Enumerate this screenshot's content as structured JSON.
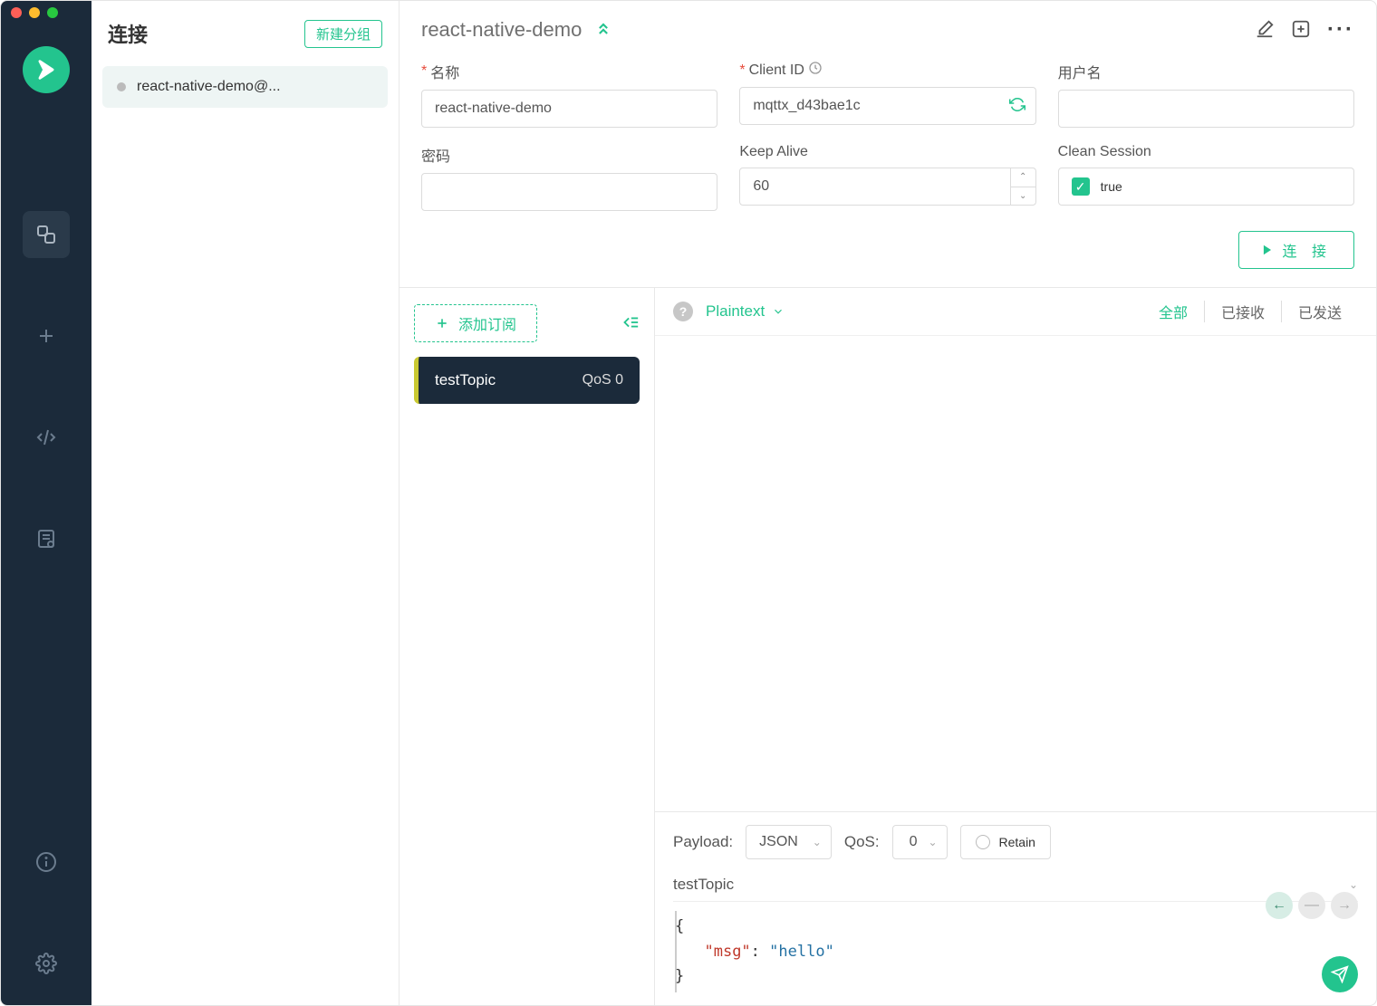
{
  "sidebar": {
    "title": "连接",
    "new_group": "新建分组",
    "connections": [
      {
        "name": "react-native-demo@..."
      }
    ]
  },
  "header": {
    "title": "react-native-demo"
  },
  "form": {
    "name_label": "名称",
    "name_value": "react-native-demo",
    "client_id_label": "Client ID",
    "client_id_value": "mqttx_d43bae1c",
    "username_label": "用户名",
    "username_value": "",
    "password_label": "密码",
    "password_value": "",
    "keep_alive_label": "Keep Alive",
    "keep_alive_value": "60",
    "clean_session_label": "Clean Session",
    "clean_session_value": "true",
    "connect_btn": "连 接"
  },
  "subs": {
    "add_btn": "添加订阅",
    "topics": [
      {
        "name": "testTopic",
        "qos": "QoS 0"
      }
    ]
  },
  "messages": {
    "payload_type": "Plaintext",
    "tabs": {
      "all": "全部",
      "received": "已接收",
      "sent": "已发送"
    }
  },
  "publish": {
    "payload_label": "Payload:",
    "payload_format": "JSON",
    "qos_label": "QoS:",
    "qos_value": "0",
    "retain_label": "Retain",
    "topic": "testTopic",
    "json_key": "\"msg\"",
    "json_value": "\"hello\""
  }
}
